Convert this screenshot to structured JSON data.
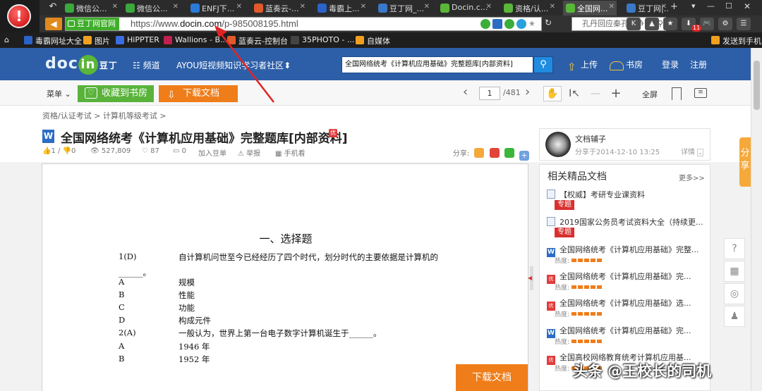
{
  "browser": {
    "tabs": [
      {
        "label": "微信公...",
        "color": "#3aa83a"
      },
      {
        "label": "微信公...",
        "color": "#3aa83a"
      },
      {
        "label": "ENFJ下...",
        "color": "#2a7ad8"
      },
      {
        "label": "蓝奏云-...",
        "color": "#e05a2a"
      },
      {
        "label": "毒霸上...",
        "color": "#2a64c8"
      },
      {
        "label": "豆丁网_...",
        "color": "#3a78c8"
      },
      {
        "label": "Docin.c...",
        "color": "#5ab638"
      },
      {
        "label": "资格/认...",
        "color": "#5ab638"
      },
      {
        "label": "全国网...",
        "color": "#5ab638"
      },
      {
        "label": "豆丁网|...",
        "color": "#3a78c8"
      }
    ],
    "active_tab_index": 8,
    "site_badge": "豆丁网官网",
    "url_prefix": "https://www.",
    "url_domain": "docin.com",
    "url_path": "/p-985008195.html",
    "search_placeholder": "孔丹回应秦孔之争",
    "toolbar_icons": [
      "K",
      "▲",
      "★",
      "⬇",
      "🎮",
      "⚙",
      "☰"
    ],
    "download_badge": "11",
    "new_tab": "+"
  },
  "bookmarks": {
    "items": [
      {
        "label": "毒霸网址大全",
        "color": "#2a64c8"
      },
      {
        "label": "图片",
        "color": "#f0a020"
      },
      {
        "label": "HiPPTER",
        "color": "#3a6ee0"
      },
      {
        "label": "Wallions - B...",
        "color": "#c02050"
      },
      {
        "label": "蓝奏云-控制台",
        "color": "#e05a2a"
      },
      {
        "label": "35PHOTO - ...",
        "color": "#444444"
      },
      {
        "label": "自媒体",
        "color": "#f0a020"
      }
    ],
    "send_to_phone": "发送到手机"
  },
  "docin": {
    "logo_text": "doc",
    "logo_in": "in",
    "logo_cn": "豆丁",
    "channel": "频道",
    "promo": "AYOU短视频知识学习者社区",
    "search_value": "全国网络统考《计算机应用基础》完整题库[内部资料]",
    "upload": "上传",
    "bookshelf": "书房",
    "login": "登录",
    "register": "注册"
  },
  "toolbar": {
    "menu": "菜单",
    "favorite": "收藏到书房",
    "download": "下载文档",
    "current_page": "1",
    "total_pages": "/481",
    "fullscreen": "全屏"
  },
  "doc": {
    "breadcrumb": "资格/认证考试 > 计算机等级考试 >",
    "title": "全国网络统考《计算机应用基础》完整题库[内部资料]",
    "stats": {
      "likes": "1 / ",
      "dislikes": "0",
      "views": "527,809",
      "hearts": "87",
      "comments": "0",
      "add_list": "加入豆单",
      "report": "举报",
      "phone_view": "手机看",
      "share_label": "分享:"
    },
    "section_title": "一、选择题",
    "lines": [
      {
        "num": "1(D)",
        "text": "自计算机问世至今已经经历了四个时代，划分时代的主要依据是计算机的"
      },
      {
        "num": "______。",
        "text": ""
      },
      {
        "num": "A",
        "text": "规模"
      },
      {
        "num": "B",
        "text": "性能"
      },
      {
        "num": "C",
        "text": "功能"
      },
      {
        "num": "D",
        "text": "构成元件"
      },
      {
        "num": "2(A)",
        "text": "一般认为，世界上第一台电子数字计算机诞生于______。"
      },
      {
        "num": "A",
        "text": "1946 年"
      },
      {
        "num": "B",
        "text": "1952 年"
      }
    ],
    "download_float": "下载文档"
  },
  "author": {
    "name": "文档辅子",
    "shared": "分享于2014-12-10 13:25",
    "details": "详情"
  },
  "related": {
    "title": "相关精品文档",
    "more": "更多>>",
    "items": [
      {
        "label": "【权威】考研专业课资料",
        "tag": "专题",
        "icon": "doc"
      },
      {
        "label": "2019国家公务员考试资料大全（持续更...",
        "tag": "专题",
        "icon": "doc"
      },
      {
        "label": "全国网络统考《计算机应用基础》完整...",
        "heat": "热度:",
        "icon": "w"
      },
      {
        "label": "全国网络统考《计算机应用基础》完...",
        "heat": "热度:",
        "icon": "you"
      },
      {
        "label": "全国网络统考《计算机应用基础》选...",
        "heat": "热度:",
        "icon": "you"
      },
      {
        "label": "全国网络统考《计算机应用基础》完...",
        "heat": "热度:",
        "icon": "w"
      },
      {
        "label": "全国高校网络教育统考计算机应用基...",
        "heat": "热度:",
        "icon": "you"
      }
    ]
  },
  "side_share": "分享",
  "watermark": "头条 @王校长的司机"
}
